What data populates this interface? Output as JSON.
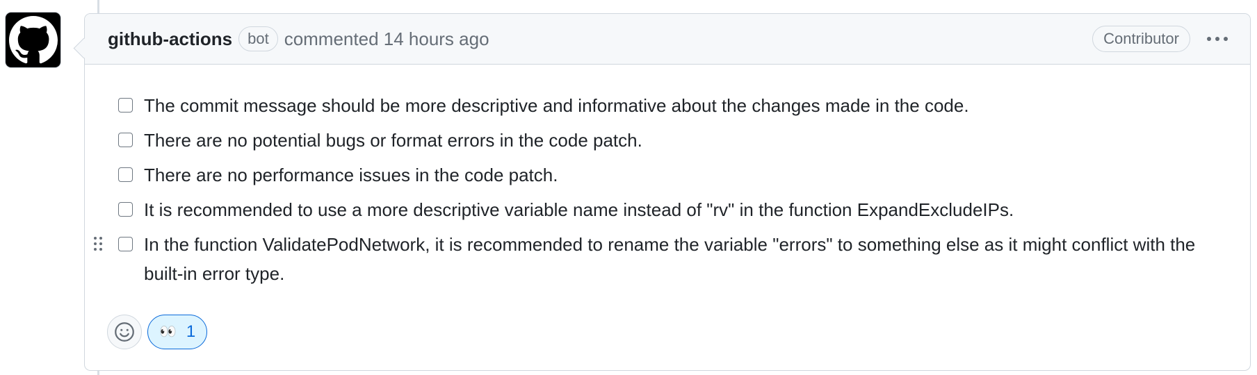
{
  "comment": {
    "author": "github-actions",
    "bot_badge": "bot",
    "action_time": "commented 14 hours ago",
    "role_badge": "Contributor",
    "tasks": [
      {
        "text": "The commit message should be more descriptive and informative about the changes made in the code.",
        "checked": false
      },
      {
        "text": "There are no potential bugs or format errors in the code patch.",
        "checked": false
      },
      {
        "text": "There are no performance issues in the code patch.",
        "checked": false
      },
      {
        "text": "It is recommended to use a more descriptive variable name instead of \"rv\" in the function ExpandExcludeIPs.",
        "checked": false
      },
      {
        "text": "In the function ValidatePodNetwork, it is recommended to rename the variable \"errors\" to something else as it might conflict with the built-in error type.",
        "checked": false
      }
    ],
    "reactions": [
      {
        "icon": "eyes-icon",
        "emoji": "👀",
        "count": "1"
      }
    ]
  },
  "colors": {
    "accent": "#0969da",
    "reaction_bg": "#ddf4ff",
    "border": "#d0d7de",
    "header_bg": "#f6f8fa",
    "muted_text": "#656d76"
  }
}
